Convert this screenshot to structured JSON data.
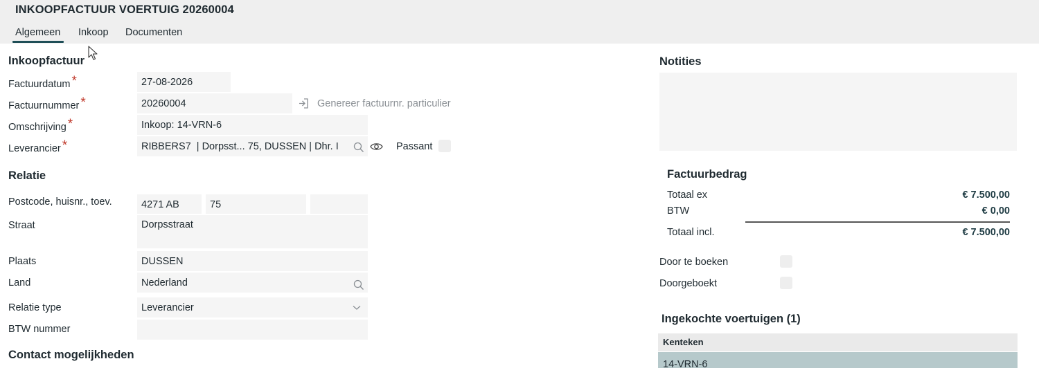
{
  "header": {
    "title": "INKOOPFACTUUR VOERTUIG 20260004",
    "tabs": [
      {
        "label": "Algemeen",
        "active": true
      },
      {
        "label": "Inkoop",
        "active": false
      },
      {
        "label": "Documenten",
        "active": false
      }
    ]
  },
  "inkoopfactuur": {
    "section_title": "Inkoopfactuur",
    "factuurdatum": {
      "label": "Factuurdatum",
      "value": "27-08-2026"
    },
    "factuurnummer": {
      "label": "Factuurnummer",
      "value": "20260004",
      "generate_label": "Genereer factuurnr. particulier"
    },
    "omschrijving": {
      "label": "Omschrijving",
      "value": "Inkoop: 14-VRN-6"
    },
    "leverancier": {
      "label": "Leverancier",
      "value": "RIBBERS7  | Dorpsst... 75, DUSSEN | Dhr. I"
    },
    "passant": {
      "label": "Passant",
      "checked": false
    },
    "required_mark": "*"
  },
  "relatie": {
    "section_title": "Relatie",
    "postcode": {
      "label": "Postcode, huisnr., toev.",
      "postcode": "4271 AB",
      "huisnr": "75",
      "toevoeging": ""
    },
    "straat": {
      "label": "Straat",
      "value": "Dorpsstraat"
    },
    "plaats": {
      "label": "Plaats",
      "value": "DUSSEN"
    },
    "land": {
      "label": "Land",
      "value": "Nederland"
    },
    "relatie_type": {
      "label": "Relatie type",
      "value": "Leverancier"
    },
    "btw_nummer": {
      "label": "BTW nummer",
      "value": ""
    }
  },
  "contact": {
    "section_title": "Contact mogelijkheden"
  },
  "notities": {
    "title": "Notities"
  },
  "factuurbedrag": {
    "title": "Factuurbedrag",
    "totaal_ex": {
      "label": "Totaal ex",
      "value": "€ 7.500,00"
    },
    "btw": {
      "label": "BTW",
      "value": "€ 0,00"
    },
    "totaal_incl": {
      "label": "Totaal incl.",
      "value": "€ 7.500,00"
    }
  },
  "boeking": {
    "door_te_boeken": {
      "label": "Door te boeken",
      "checked": false
    },
    "doorgeboekt": {
      "label": "Doorgeboekt",
      "checked": false
    }
  },
  "voertuigen": {
    "title": "Ingekochte voertuigen (1)",
    "column": "Kenteken",
    "rows": [
      "14-VRN-6"
    ]
  },
  "colors": {
    "accent": "#1f4e57",
    "required": "#c0392b",
    "selected_row": "#b6c9cb"
  }
}
